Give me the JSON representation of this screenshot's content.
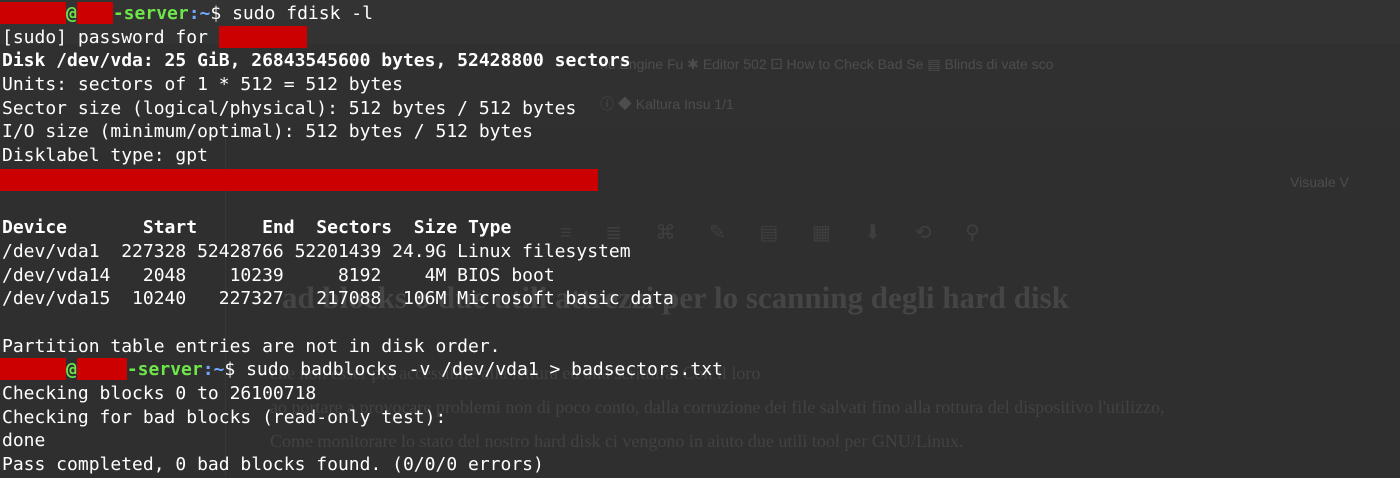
{
  "background": {
    "tabs": "nu Engine Fu   ✱ Editor 502   ⚀ How to Check Bad Se   ▤ Blinds di vate sco",
    "toolbar": "ⓘ  ◆  Kaltura Insu  1/1",
    "side_label": "Visuale   V",
    "editor_icons": "≡ ≣ ⌘ ✎ ▤ ▦ ⬇ ⟲ ⚲",
    "title": "ad blocks o                  due utili attrezzi per lo scanning degli hard disk",
    "para_1": "                                                   che non esser più accessibile alla lettura ed alla scrittura. Con il loro",
    "para_2": "                   ao portare a provocare problemi non di poco conto, dalla corruzione dei file salvati fino alla rottura del dispositivo l'utilizzo,",
    "para_3": "Come monitorare lo stato del nostro hard disk ci vengono in aiuto due utili tool per GNU/Linux."
  },
  "terminal": {
    "prompt": {
      "at": "@",
      "host_suffix": "-server",
      "path": ":~",
      "symbol": "$ "
    },
    "cmd1": "sudo fdisk -l",
    "sudo_prompt": "[sudo] password for ",
    "disk_line": "Disk /dev/vda: 25 GiB, 26843545600 bytes, 52428800 sectors",
    "units": "Units: sectors of 1 * 512 = 512 bytes",
    "sector_size": "Sector size (logical/physical): 512 bytes / 512 bytes",
    "io_size": "I/O size (minimum/optimal): 512 bytes / 512 bytes",
    "disklabel": "Disklabel type: gpt",
    "table_header": "Device       Start      End  Sectors  Size Type",
    "rows": [
      "/dev/vda1  227328 52428766 52201439 24.9G Linux filesystem",
      "/dev/vda14   2048    10239     8192    4M BIOS boot",
      "/dev/vda15  10240   227327   217088  106M Microsoft basic data"
    ],
    "partition_note": "Partition table entries are not in disk order.",
    "cmd2": "sudo badblocks -v /dev/vda1 > badsectors.txt",
    "check1": "Checking blocks 0 to 26100718",
    "check2": "Checking for bad blocks (read-only test):",
    "done": "done",
    "pass": "Pass completed, 0 bad blocks found. (0/0/0 errors)"
  }
}
